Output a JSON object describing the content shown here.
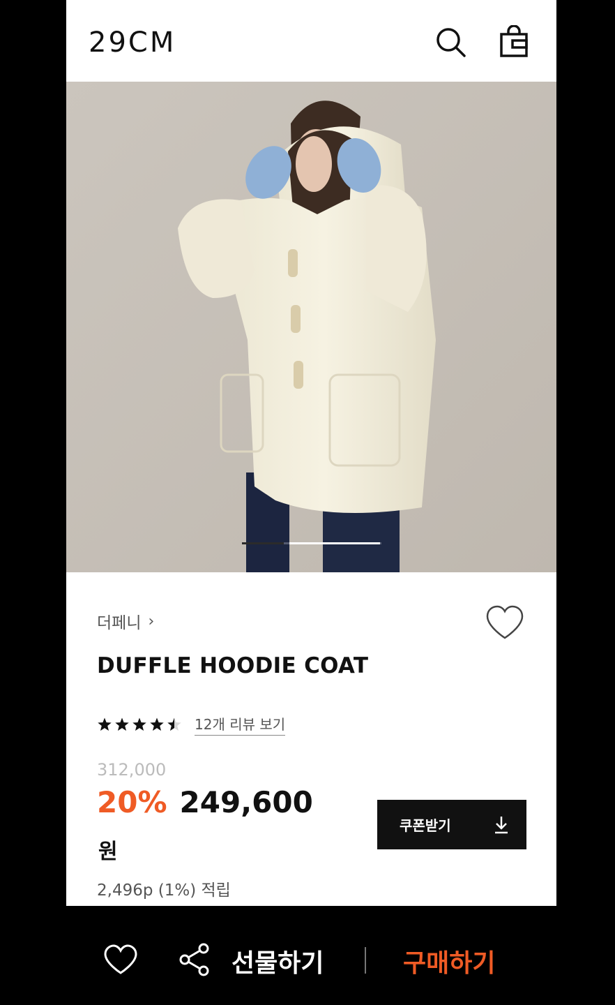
{
  "header": {
    "logo": "29CM",
    "search_icon": "search-icon",
    "bag_icon": "shopping-bag-icon"
  },
  "hero": {
    "image_alt": "Model wearing cream duffle hoodie coat",
    "pager_count": 2,
    "pager_active": 2
  },
  "product": {
    "brand": "더페니",
    "brand_chevron": "›",
    "wish_icon": "heart-outline-icon",
    "name": "DUFFLE HOODIE COAT",
    "rating": 4.5,
    "review_link": "12개 리뷰 보기",
    "original_price": "312,000",
    "discount": "20%",
    "sale_price": "249,600",
    "currency": "원",
    "points": "2,496p (1%) 적립",
    "coupon_button": "쿠폰받기",
    "coupon_icon": "download-icon"
  },
  "bottom_bar": {
    "like_icon": "heart-outline-icon",
    "share_icon": "share-icon",
    "gift_label": "선물하기",
    "buy_label": "구매하기"
  },
  "colors": {
    "accent": "#ef5b25",
    "text": "#111111",
    "muted": "#555555",
    "hero_bg": "#c7c1b9"
  }
}
